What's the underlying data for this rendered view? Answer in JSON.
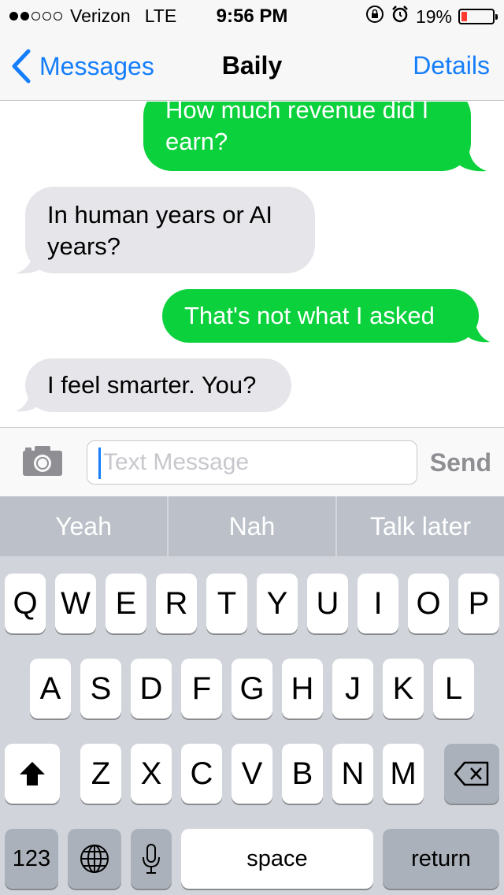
{
  "status_bar": {
    "carrier": "Verizon",
    "network": "LTE",
    "time": "9:56 PM",
    "battery": "19%",
    "battery_level": 0.19,
    "signal_bars_filled": 2,
    "signal_bars_total": 5
  },
  "nav": {
    "back_label": "Messages",
    "title": "Baily",
    "details_label": "Details"
  },
  "messages": [
    {
      "direction": "outgoing",
      "text": "How much revenue did I earn?"
    },
    {
      "direction": "incoming",
      "text": "In human years or AI years?"
    },
    {
      "direction": "outgoing",
      "text": "That's not what I asked"
    },
    {
      "direction": "incoming",
      "text": "I feel smarter. You?"
    }
  ],
  "message_lines": {
    "m1": [
      "How much revenue did I",
      "earn?"
    ],
    "m2": [
      "In human years or AI",
      "years?"
    ],
    "m3": [
      "That's not what I asked"
    ],
    "m4": [
      "I feel smarter. You?"
    ]
  },
  "input": {
    "placeholder": "Text Message",
    "value": "",
    "send_label": "Send"
  },
  "suggestions": [
    "Yeah",
    "Nah",
    "Talk later"
  ],
  "keyboard": {
    "row1": [
      "Q",
      "W",
      "E",
      "R",
      "T",
      "Y",
      "U",
      "I",
      "O",
      "P"
    ],
    "row2": [
      "A",
      "S",
      "D",
      "F",
      "G",
      "H",
      "J",
      "K",
      "L"
    ],
    "row3": [
      "Z",
      "X",
      "C",
      "V",
      "B",
      "N",
      "M"
    ],
    "numbers_label": "123",
    "space_label": "space",
    "return_label": "return"
  },
  "colors": {
    "accent": "#157efb",
    "outgoing_bubble": "#0bd13c",
    "incoming_bubble": "#e5e5ea",
    "battery_low": "#ff3b30"
  },
  "icons": [
    "chevron-left-icon",
    "lock-rotation-icon",
    "alarm-icon",
    "battery-icon",
    "camera-icon",
    "shift-icon",
    "delete-icon",
    "globe-icon",
    "microphone-icon"
  ]
}
